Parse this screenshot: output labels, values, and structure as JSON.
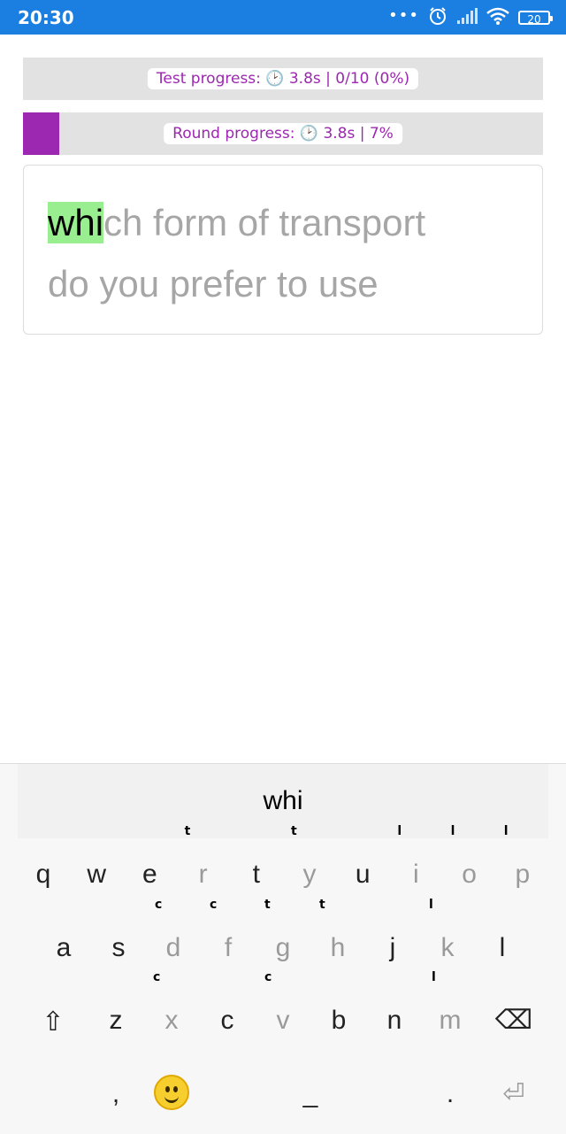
{
  "status": {
    "time": "20:30",
    "dots": "•••",
    "alarm_icon": "alarm-icon",
    "signal_icon": "signal-icon",
    "wifi_icon": "wifi-icon",
    "battery": "20"
  },
  "test_progress": {
    "label": "Test progress: 🕑 3.8s | 0/10 (0%)",
    "fraction": 0
  },
  "round_progress": {
    "label": "Round progress: 🕑 3.8s | 7%",
    "fraction": 0.07
  },
  "phrase": {
    "typed": "whi",
    "line1_rest": "ch form of transport",
    "line2": "do you prefer to use"
  },
  "keyboard": {
    "suggestion": "whi",
    "row1": [
      {
        "key": "q",
        "style": "dark",
        "hint": ""
      },
      {
        "key": "w",
        "style": "dark",
        "hint": ""
      },
      {
        "key": "e",
        "style": "dark",
        "hint": ""
      },
      {
        "key": "r",
        "style": "light",
        "hint": "t"
      },
      {
        "key": "t",
        "style": "dark",
        "hint": ""
      },
      {
        "key": "y",
        "style": "light",
        "hint": "t"
      },
      {
        "key": "u",
        "style": "dark",
        "hint": ""
      },
      {
        "key": "i",
        "style": "light",
        "hint": "l"
      },
      {
        "key": "o",
        "style": "light",
        "hint": "l"
      },
      {
        "key": "p",
        "style": "light",
        "hint": "l"
      }
    ],
    "row2": [
      {
        "key": "a",
        "style": "dark",
        "hint": ""
      },
      {
        "key": "s",
        "style": "dark",
        "hint": ""
      },
      {
        "key": "d",
        "style": "light",
        "hint": "c"
      },
      {
        "key": "f",
        "style": "light",
        "hint": "c"
      },
      {
        "key": "g",
        "style": "light",
        "hint": "t"
      },
      {
        "key": "h",
        "style": "light",
        "hint": "t"
      },
      {
        "key": "j",
        "style": "dark",
        "hint": ""
      },
      {
        "key": "k",
        "style": "light",
        "hint": "l"
      },
      {
        "key": "l",
        "style": "dark",
        "hint": ""
      }
    ],
    "row3": [
      {
        "key": "z",
        "style": "dark",
        "hint": ""
      },
      {
        "key": "x",
        "style": "light",
        "hint": "c"
      },
      {
        "key": "c",
        "style": "dark",
        "hint": ""
      },
      {
        "key": "v",
        "style": "light",
        "hint": "c"
      },
      {
        "key": "b",
        "style": "dark",
        "hint": ""
      },
      {
        "key": "n",
        "style": "dark",
        "hint": ""
      },
      {
        "key": "m",
        "style": "light",
        "hint": "l"
      }
    ],
    "shift": "⇧",
    "backspace": "⌫",
    "comma": ",",
    "emoji_icon": "smiley-icon",
    "space": "_",
    "period": ".",
    "enter": "⏎"
  }
}
